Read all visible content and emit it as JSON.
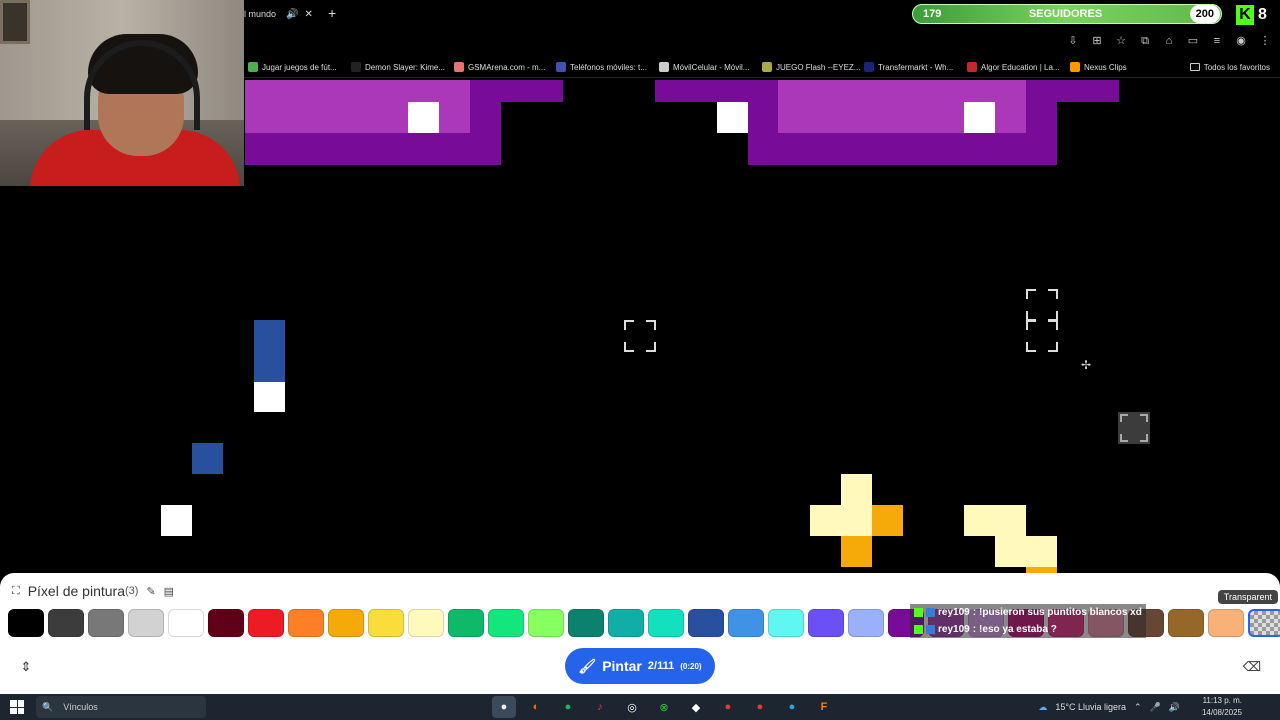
{
  "browser": {
    "tab_title": "l mundo",
    "bookmarks": [
      {
        "label": "Jugar juegos de fút...",
        "color": "#4caf50"
      },
      {
        "label": "Demon Slayer: Kime...",
        "color": "#222222"
      },
      {
        "label": "GSMArena.com - m...",
        "color": "#e57373"
      },
      {
        "label": "Teléfonos móviles: t...",
        "color": "#3f51b5"
      },
      {
        "label": "MóvilCelular - Móvil...",
        "color": "#cccccc"
      },
      {
        "label": "JUEGO Flash --EYEZ...",
        "color": "#aaaa44"
      },
      {
        "label": "Transfermarkt - Wh...",
        "color": "#1a237e"
      },
      {
        "label": "Algor Education | La...",
        "color": "#c62828"
      },
      {
        "label": "Nexus Clips",
        "color": "#ff9800"
      }
    ],
    "all_bookmarks": "Todos los favoritos"
  },
  "overlay": {
    "followers_current": "179",
    "followers_label": "SEGUIDORES",
    "followers_goal": "200",
    "followers_progress": 0.895,
    "kick_count": "8"
  },
  "paint_panel": {
    "title": "Píxel de pintura",
    "title_count": "(3)",
    "paint_label": "Pintar",
    "paint_progress": "2/111",
    "paint_timer": "(0:20)",
    "transparent_tooltip": "Transparent",
    "palette": [
      "#000000",
      "#3c3c3c",
      "#787878",
      "#d2d2d2",
      "#ffffff",
      "#600018",
      "#ed1c24",
      "#ff7f27",
      "#f6aa09",
      "#f9dd3b",
      "#fffabc",
      "#0eb968",
      "#13e67b",
      "#87ff5e",
      "#0c816e",
      "#10aea6",
      "#13e1be",
      "#28509e",
      "#4093e4",
      "#60f7f2",
      "#6b50f6",
      "#99b1fb",
      "#780c99",
      "#aa38b9",
      "#e09ff9",
      "#cb007a",
      "#ec1f80",
      "#f38da9",
      "#684634",
      "#95682a",
      "#f8b277",
      "transparent"
    ]
  },
  "chat": [
    {
      "user": "rey109",
      "message": "!pusieron sus puntitos blancos xd"
    },
    {
      "user": "rey109",
      "message": "!eso ya estaba ?"
    }
  ],
  "taskbar": {
    "search_label": "Vínculos",
    "weather": "15°C  Lluvia ligera",
    "time": "11:13 p. m.",
    "date": "14/08/2025"
  }
}
